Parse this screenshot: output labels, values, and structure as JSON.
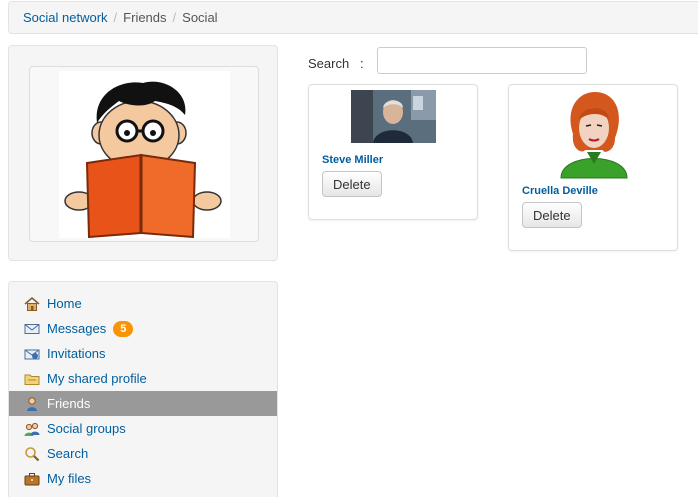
{
  "breadcrumb": {
    "items": [
      "Social network",
      "Friends",
      "Social"
    ],
    "separator": "/"
  },
  "profile": {
    "avatar_icon": "reading-boy-avatar"
  },
  "menu": {
    "items": [
      {
        "label": "Home",
        "icon": "home-icon"
      },
      {
        "label": "Messages",
        "icon": "envelope-icon",
        "badge": "5"
      },
      {
        "label": "Invitations",
        "icon": "invitation-icon"
      },
      {
        "label": "My shared profile",
        "icon": "folder-icon"
      },
      {
        "label": "Friends",
        "icon": "friends-icon",
        "active": true
      },
      {
        "label": "Social groups",
        "icon": "groups-icon"
      },
      {
        "label": "Search",
        "icon": "magnifier-icon"
      },
      {
        "label": "My files",
        "icon": "briefcase-icon"
      }
    ]
  },
  "search": {
    "label": "Search",
    "colon": ":",
    "value": ""
  },
  "friends": [
    {
      "name": "Steve Miller",
      "delete_label": "Delete",
      "photo": "photo-portrait"
    },
    {
      "name": "Cruella Deville",
      "delete_label": "Delete",
      "photo": "redhead-avatar"
    }
  ],
  "colors": {
    "link": "#005e9e",
    "active_bg": "#999999",
    "badge": "#f89406"
  }
}
